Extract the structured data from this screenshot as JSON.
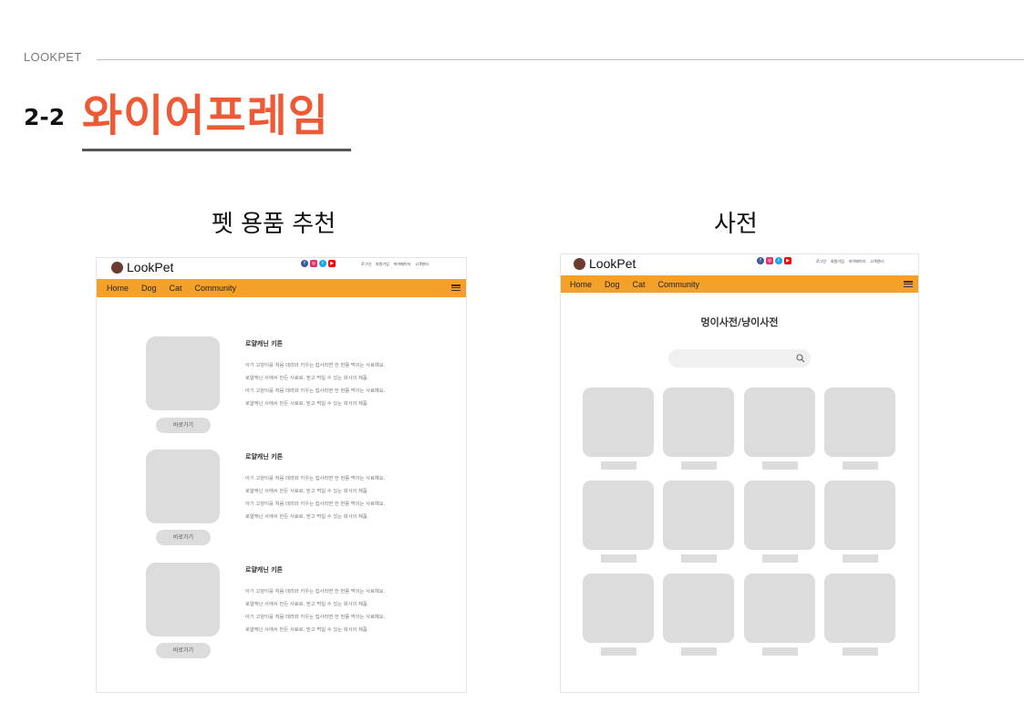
{
  "header": {
    "brand": "LOOKPET",
    "section_number": "2-2",
    "section_title": "와이어프레임"
  },
  "left_panel": {
    "caption": "펫 용품 추천",
    "logo_text": "LookPet",
    "top_links": [
      "로그인",
      "회원가입",
      "마이페이지",
      "고객센터"
    ],
    "nav": [
      "Home",
      "Dog",
      "Cat",
      "Community"
    ],
    "products": [
      {
        "title": "로얄캐닌 키튼",
        "lines": [
          "아기 고양이를 처음 데려와 키우는 집사라면 한 번쯤 먹이는 사료예요.",
          "로얄캐닌 사에서 만든 사료로, 믿고 먹일 수 있는 회사의 제품.",
          "아기 고양이를 처음 데려와 키우는 집사라면 한 번쯤 먹이는 사료예요.",
          "로얄캐닌 사에서 만든 사료로, 믿고 먹일 수 있는 회사의 제품."
        ],
        "button": "바로가기"
      },
      {
        "title": "로얄캐닌 키튼",
        "lines": [
          "아기 고양이를 처음 데려와 키우는 집사라면 한 번쯤 먹이는 사료예요.",
          "로얄캐닌 사에서 만든 사료로, 믿고 먹일 수 있는 회사의 제품.",
          "아기 고양이를 처음 데려와 키우는 집사라면 한 번쯤 먹이는 사료예요.",
          "로얄캐닌 사에서 만든 사료로, 믿고 먹일 수 있는 회사의 제품."
        ],
        "button": "바로가기"
      },
      {
        "title": "로얄캐닌 키튼",
        "lines": [
          "아기 고양이를 처음 데려와 키우는 집사라면 한 번쯤 먹이는 사료예요.",
          "로얄캐닌 사에서 만든 사료로, 믿고 먹일 수 있는 회사의 제품.",
          "아기 고양이를 처음 데려와 키우는 집사라면 한 번쯤 먹이는 사료예요.",
          "로얄캐닌 사에서 만든 사료로, 믿고 먹일 수 있는 회사의 제품."
        ],
        "button": "바로가기"
      }
    ]
  },
  "right_panel": {
    "caption": "사전",
    "logo_text": "LookPet",
    "top_links": [
      "로그인",
      "회원가입",
      "마이페이지",
      "고객센터"
    ],
    "nav": [
      "Home",
      "Dog",
      "Cat",
      "Community"
    ],
    "dictionary_title": "멍이사전/냥이사전",
    "grid_rows": 3,
    "grid_cols": 4
  },
  "colors": {
    "accent": "#ee5a35",
    "nav_bar": "#f4a12a",
    "placeholder": "#dcdcdc",
    "logo_dot": "#6b3b2f",
    "social": [
      "#3b5998",
      "#e1306c",
      "#1da1f2",
      "#ff0000"
    ]
  },
  "icons": [
    "facebook-icon",
    "instagram-icon",
    "twitter-icon",
    "youtube-icon",
    "hamburger-menu-icon",
    "search-icon"
  ]
}
